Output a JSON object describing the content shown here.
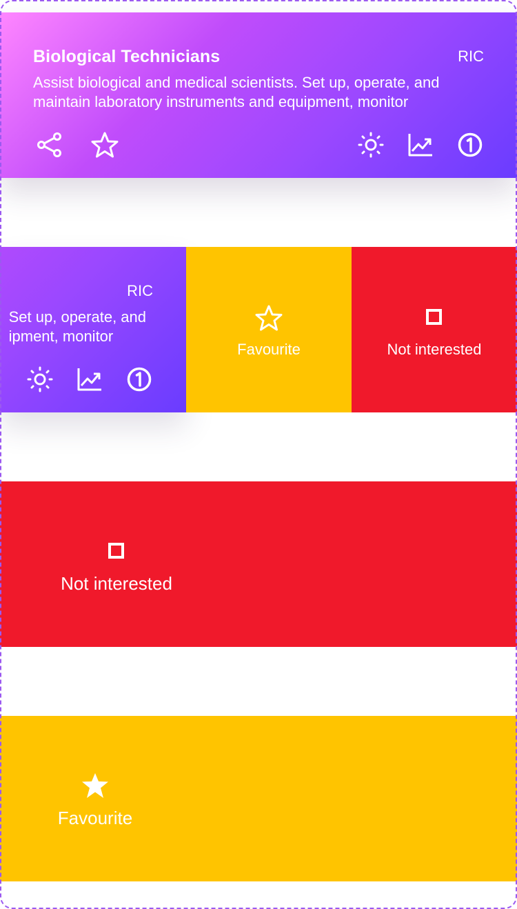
{
  "card": {
    "title": "Biological Technicians",
    "code": "RIC",
    "description_line1": "Assist biological and medical scientists. Set up, operate, and",
    "description_line2": "maintain laboratory instruments and equipment, monitor",
    "icons": [
      "share-icon",
      "star-outline-icon",
      "sun-icon",
      "trending-up-icon",
      "number-one-circle-icon"
    ],
    "gradient": [
      "#ff86ff",
      "#c04cfb",
      "#9b48ff",
      "#6a3cff"
    ]
  },
  "swipe_card": {
    "code": "RIC",
    "description_line1": "Set up, operate, and",
    "description_line2": "ipment, monitor"
  },
  "actions": {
    "favourite_label": "Favourite",
    "not_interested_label": "Not interested"
  },
  "colors": {
    "favourite": "#ffc400",
    "not_interested": "#f0192b"
  }
}
